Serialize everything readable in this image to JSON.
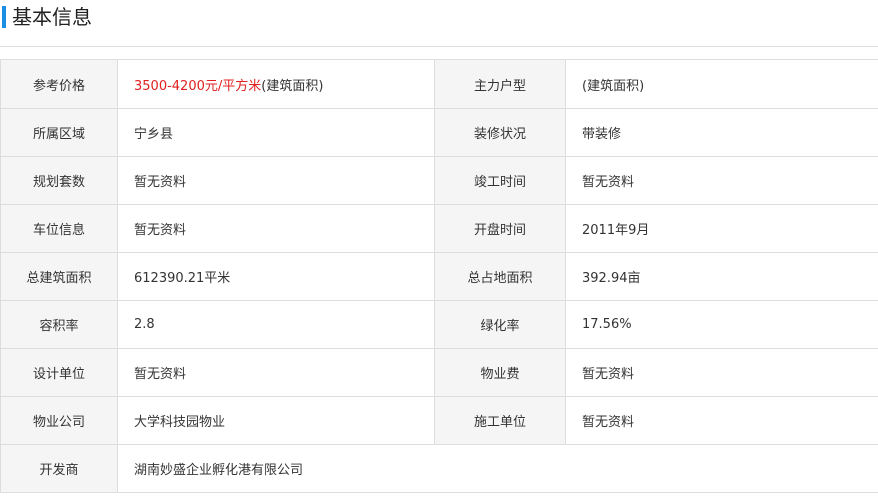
{
  "section": {
    "title": "基本信息"
  },
  "colors": {
    "accent": "#1a8fe3",
    "price": "#e02020",
    "label_bg": "#f5f5f5",
    "border": "#dddddd"
  },
  "rows": [
    {
      "left": {
        "label": "参考价格",
        "value_price": "3500-4200元/平方米",
        "value_suffix": "(建筑面积)"
      },
      "right": {
        "label": "主力户型",
        "value": "(建筑面积)"
      }
    },
    {
      "left": {
        "label": "所属区域",
        "value": "宁乡县"
      },
      "right": {
        "label": "装修状况",
        "value": "带装修"
      }
    },
    {
      "left": {
        "label": "规划套数",
        "value": "暂无资料"
      },
      "right": {
        "label": "竣工时间",
        "value": "暂无资料"
      }
    },
    {
      "left": {
        "label": "车位信息",
        "value": "暂无资料"
      },
      "right": {
        "label": "开盘时间",
        "value": "2011年9月"
      }
    },
    {
      "left": {
        "label": "总建筑面积",
        "value": "612390.21平米"
      },
      "right": {
        "label": "总占地面积",
        "value": "392.94亩"
      }
    },
    {
      "left": {
        "label": "容积率",
        "value": "2.8"
      },
      "right": {
        "label": "绿化率",
        "value": "17.56%"
      }
    },
    {
      "left": {
        "label": "设计单位",
        "value": "暂无资料"
      },
      "right": {
        "label": "物业费",
        "value": "暂无资料"
      }
    },
    {
      "left": {
        "label": "物业公司",
        "value": "大学科技园物业"
      },
      "right": {
        "label": "施工单位",
        "value": "暂无资料"
      }
    },
    {
      "full": {
        "label": "开发商",
        "value": "湖南妙盛企业孵化港有限公司"
      }
    }
  ]
}
